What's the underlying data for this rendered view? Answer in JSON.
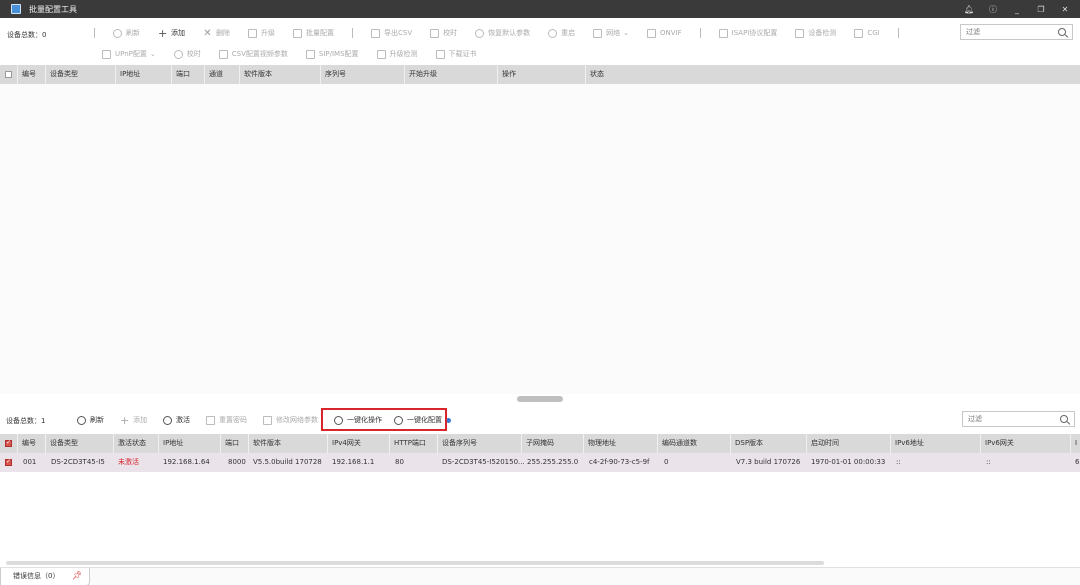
{
  "window": {
    "title": "批量配置工具"
  },
  "top_panel": {
    "device_count": "设备总数：0",
    "toolbar_row1": [
      "刷新",
      "添加",
      "删除",
      "升级",
      "批量配置",
      "导出CSV",
      "校时",
      "恢复默认参数",
      "重启",
      "网络",
      "ONVIF",
      "ISAPI协议配置",
      "设备检测",
      "CGI"
    ],
    "toolbar_row2": [
      "UPnP配置",
      "校时",
      "CSV配置视频参数",
      "SIP/IMS配置",
      "升级检测",
      "下载证书"
    ],
    "filter_placeholder": "过滤",
    "columns": [
      "编号",
      "设备类型",
      "IP地址",
      "端口",
      "通道",
      "软件版本",
      "序列号",
      "开始升级",
      "操作",
      "状态"
    ]
  },
  "bottom_panel": {
    "device_count": "设备总数：1",
    "toolbar": {
      "refresh": "刷新",
      "add": "添加",
      "activate": "激活",
      "reset_password": "重置密码",
      "modify_network": "修改网络参数",
      "one_key_op": "一键化操作",
      "one_key_config": "一键化配置"
    },
    "filter_placeholder": "过滤",
    "columns": [
      "编号",
      "设备类型",
      "激活状态",
      "IP地址",
      "端口",
      "软件版本",
      "IPv4网关",
      "HTTP端口",
      "设备序列号",
      "子网掩码",
      "物理地址",
      "编码通道数",
      "DSP版本",
      "启动时间",
      "IPv6地址",
      "IPv6网关",
      "I"
    ],
    "rows": [
      {
        "id": "001",
        "type": "DS-2CD3T45-I5",
        "status": "未激活",
        "ip": "192.168.1.64",
        "port": "8000",
        "sw": "V5.5.0build 170728",
        "gateway": "192.168.1.1",
        "http": "80",
        "serial": "DS-2CD3T45-I520150...",
        "mask": "255.255.255.0",
        "mac": "c4-2f-90-73-c5-9f",
        "channels": "0",
        "dsp": "V7.3 build 170726",
        "boot": "1970-01-01 00:00:33",
        "ipv6": "::",
        "ipv6gw": "::",
        "extra": "6"
      }
    ]
  },
  "footer": {
    "error_tab": "错误信息（0）"
  },
  "colors": {
    "highlight": "#d9262e",
    "titlebar": "#3a3a3a",
    "header": "#d9d9d9",
    "selected_row": "#eae3ea"
  }
}
